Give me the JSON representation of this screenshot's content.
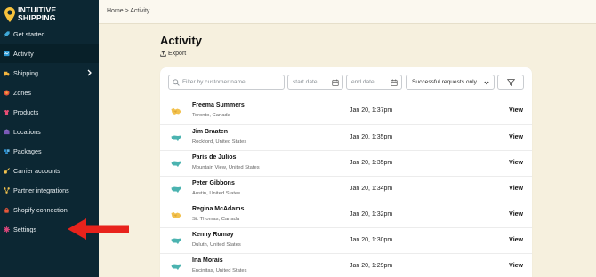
{
  "brand": {
    "name_line1": "INTUITIVE",
    "name_line2": "SHIPPING",
    "pin_color": "#f7c23c"
  },
  "sidebar": {
    "items": [
      {
        "label": "Get started",
        "icon": "rocket-icon",
        "color": "#3fa9d8"
      },
      {
        "label": "Activity",
        "icon": "activity-icon",
        "color": "#2e9bd6",
        "active": true
      },
      {
        "label": "Shipping",
        "icon": "shipping-icon",
        "color": "#f3b63f",
        "has_chevron": true
      },
      {
        "label": "Zones",
        "icon": "zones-icon",
        "color": "#e2553d"
      },
      {
        "label": "Products",
        "icon": "products-icon",
        "color": "#e64d74"
      },
      {
        "label": "Locations",
        "icon": "locations-icon",
        "color": "#7b58b8"
      },
      {
        "label": "Packages",
        "icon": "packages-icon",
        "color": "#2d8fd0"
      },
      {
        "label": "Carrier accounts",
        "icon": "key-icon",
        "color": "#f2c14e"
      },
      {
        "label": "Partner integrations",
        "icon": "integrations-icon",
        "color": "#f2c14e"
      },
      {
        "label": "Shopify connection",
        "icon": "shopify-icon",
        "color": "#e7573a"
      },
      {
        "label": "Settings",
        "icon": "gear-icon",
        "color": "#d9467a"
      }
    ]
  },
  "breadcrumb": "Home > Activity",
  "page": {
    "title": "Activity",
    "export_label": "Export"
  },
  "filters": {
    "search_placeholder": "Filter by customer name",
    "start_date_placeholder": "start date",
    "end_date_placeholder": "end date",
    "request_filter_selected": "Successful requests only"
  },
  "activity_rows": [
    {
      "name": "Freema Summers",
      "location": "Toronto, Canada",
      "timestamp": "Jan 20, 1:37pm",
      "action": "View",
      "country_flag": "canada-flag-icon"
    },
    {
      "name": "Jim Braaten",
      "location": "Rockford, United States",
      "timestamp": "Jan 20, 1:35pm",
      "action": "View",
      "country_flag": "usa-flag-icon"
    },
    {
      "name": "Paris de Julios",
      "location": "Mountain View, United States",
      "timestamp": "Jan 20, 1:35pm",
      "action": "View",
      "country_flag": "usa-flag-icon"
    },
    {
      "name": "Peter Gibbons",
      "location": "Austin, United States",
      "timestamp": "Jan 20, 1:34pm",
      "action": "View",
      "country_flag": "usa-flag-icon"
    },
    {
      "name": "Regina McAdams",
      "location": "St. Thomas, Canada",
      "timestamp": "Jan 20, 1:32pm",
      "action": "View",
      "country_flag": "canada-flag-icon"
    },
    {
      "name": "Kenny Romay",
      "location": "Duluth, United States",
      "timestamp": "Jan 20, 1:30pm",
      "action": "View",
      "country_flag": "usa-flag-icon"
    },
    {
      "name": "Ina Morais",
      "location": "Encinitas, United States",
      "timestamp": "Jan 20, 1:29pm",
      "action": "View",
      "country_flag": "usa-flag-icon"
    }
  ],
  "colors": {
    "sidebar_bg": "#0c2733",
    "page_bg": "#f6f0de",
    "annotation_arrow": "#e8231c",
    "usa_flag": "#4bb3b0",
    "canada_flag": "#f2c14e"
  }
}
